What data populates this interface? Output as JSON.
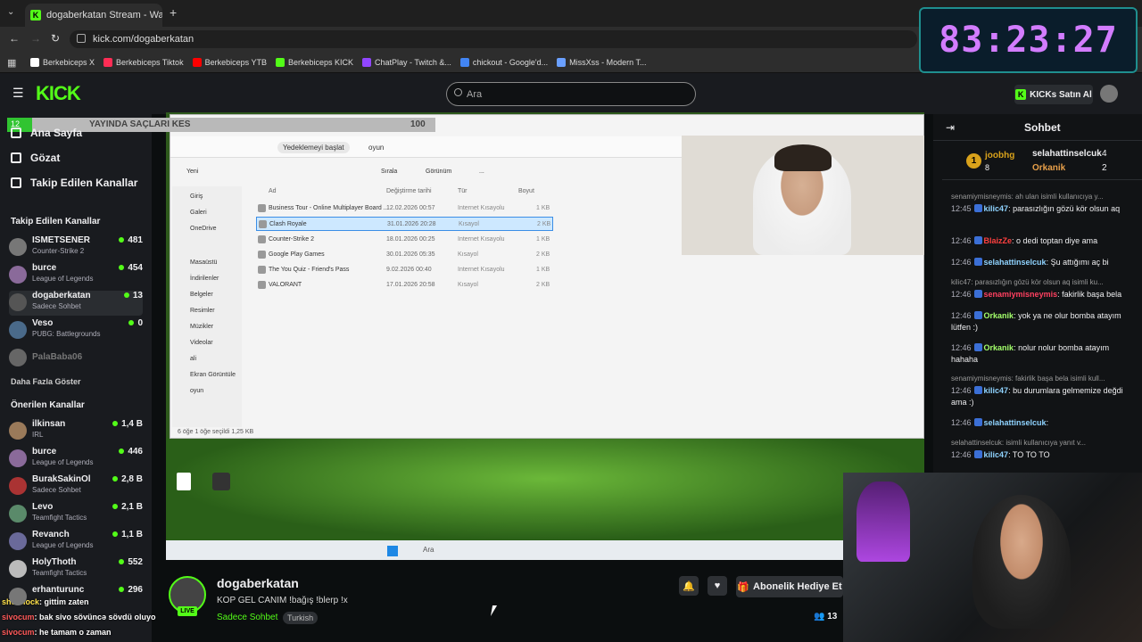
{
  "browser": {
    "tab_title": "dogaberkatan Stream - Wa",
    "url": "kick.com/dogaberkatan",
    "bookmarks": [
      {
        "label": "Berkebiceps X",
        "color": "#ffffff"
      },
      {
        "label": "Berkebiceps Tiktok",
        "color": "#ff2d55"
      },
      {
        "label": "Berkebiceps YTB",
        "color": "#ff0000"
      },
      {
        "label": "Berkebiceps KICK",
        "color": "#53fc18"
      },
      {
        "label": "ChatPlay - Twitch &...",
        "color": "#9146ff"
      },
      {
        "label": "chickout - Google'd...",
        "color": "#4285f4"
      },
      {
        "label": "MissXss - Modern T...",
        "color": "#6aa0ff"
      }
    ]
  },
  "timer": "83:23:27",
  "kick": {
    "logo": "KICK",
    "search_placeholder": "Ara",
    "buy_kicks": "KICKs Satın Al"
  },
  "sidebar": {
    "nav": [
      {
        "label": "Ana Sayfa",
        "icon": "home-icon"
      },
      {
        "label": "Gözat",
        "icon": "browse-icon"
      },
      {
        "label": "Takip Edilen Kanallar",
        "icon": "heart-icon"
      }
    ],
    "followed_title": "Takip Edilen Kanallar",
    "followed": [
      {
        "name": "ISMETSENER",
        "category": "Counter-Strike 2",
        "viewers": "481",
        "color": "#777"
      },
      {
        "name": "burce",
        "category": "League of Legends",
        "viewers": "454",
        "color": "#8a6a9a"
      },
      {
        "name": "dogaberkatan",
        "category": "Sadece Sohbet",
        "viewers": "13",
        "color": "#555"
      },
      {
        "name": "Veso",
        "category": "PUBG: Battlegrounds",
        "viewers": "0",
        "color": "#4a6a8a"
      },
      {
        "name": "PalaBaba06",
        "category": "",
        "viewers": "",
        "color": "#666"
      }
    ],
    "show_more": "Daha Fazla Göster",
    "recommended_title": "Önerilen Kanallar",
    "recommended": [
      {
        "name": "ilkinsan",
        "category": "IRL",
        "viewers": "1,4 B",
        "color": "#9a7a5a"
      },
      {
        "name": "burce",
        "category": "League of Legends",
        "viewers": "446",
        "color": "#8a6a9a"
      },
      {
        "name": "BurakSakinOl",
        "category": "Sadece Sohbet",
        "viewers": "2,8 B",
        "color": "#aa3333"
      },
      {
        "name": "Levo",
        "category": "Teamfight Tactics",
        "viewers": "2,1 B",
        "color": "#5a8a6a"
      },
      {
        "name": "Revanch",
        "category": "League of Legends",
        "viewers": "1,1 B",
        "color": "#6a6a9a"
      },
      {
        "name": "HolyThoth",
        "category": "Teamfight Tactics",
        "viewers": "552",
        "color": "#bbbbbb"
      },
      {
        "name": "erhanturunc",
        "category": "",
        "viewers": "296",
        "color": "#777"
      }
    ]
  },
  "video": {
    "overlay_value": "12",
    "overlay_title": "YAYINDA SAÇLARI KES",
    "overlay_target": "100",
    "explorer": {
      "breadcrumb_start": "Yedeklemeyi başlat",
      "breadcrumb_folder": "oyun",
      "toolbar": [
        "Yeni",
        "Sırala",
        "Görünüm",
        "..."
      ],
      "columns": [
        "Ad",
        "Değiştirme tarihi",
        "Tür",
        "Boyut"
      ],
      "files": [
        {
          "name": "Business Tour - Online Multiplayer Board ...",
          "date": "12.02.2026 00:57",
          "type": "Internet Kısayolu",
          "size": "1 KB"
        },
        {
          "name": "Clash Royale",
          "date": "31.01.2026 20:28",
          "type": "Kısayol",
          "size": "2 KB"
        },
        {
          "name": "Counter-Strike 2",
          "date": "18.01.2026 00:25",
          "type": "Internet Kısayolu",
          "size": "1 KB"
        },
        {
          "name": "Google Play Games",
          "date": "30.01.2026 05:35",
          "type": "Kısayol",
          "size": "2 KB"
        },
        {
          "name": "The You Quiz - Friend's Pass",
          "date": "9.02.2026 00:40",
          "type": "Internet Kısayolu",
          "size": "1 KB"
        },
        {
          "name": "VALORANT",
          "date": "17.01.2026 20:58",
          "type": "Kısayol",
          "size": "2 KB"
        }
      ],
      "side": [
        "Giriş",
        "Galeri",
        "OneDrive",
        "Masaüstü",
        "İndirilenler",
        "Belgeler",
        "Resimler",
        "Müzikler",
        "Videolar",
        "ali",
        "Ekran Görüntüle",
        "oyun"
      ],
      "status": "6 öğe    1 öğe seçildi  1,25 KB"
    },
    "taskbar_search": "Ara"
  },
  "stream": {
    "streamer": "dogaberkatan",
    "live": "LIVE",
    "title": "KOP GEL CANIM !bağış !blerp !x",
    "category": "Sadece Sohbet",
    "language": "Turkish",
    "subscribe_gift": "Abonelik Hediye Et",
    "viewers": "13"
  },
  "chat": {
    "title": "Sohbet",
    "leaders": [
      {
        "name": "joobhg",
        "count": "8"
      },
      {
        "name": "selahattinselcuk",
        "count": "4"
      },
      {
        "name": "Orkanik",
        "count": "2"
      }
    ],
    "messages": [
      {
        "reply": "senamiymisneymis: ah ulan isimli kullanıcıya y...",
        "time": "12:45",
        "user": "kilic47",
        "color": "#8fd3ff",
        "text": ": parasızlığın gözü kör olsun aq"
      },
      {
        "time": "12:46",
        "user": "BlaizZe",
        "color": "#ff4040",
        "text": ": o dedi toptan diye ama"
      },
      {
        "time": "12:46",
        "user": "selahattinselcuk",
        "color": "#8fd3ff",
        "text": ": Şu attığımı aç bi"
      },
      {
        "reply": "kilic47: parasızlığın gözü kör olsun aq isimli ku...",
        "time": "12:46",
        "user": "senamiymisneymis",
        "color": "#ff4060",
        "text": ": fakirlik başa bela"
      },
      {
        "time": "12:46",
        "user": "Orkanik",
        "color": "#a4ff6b",
        "text": ": yok ya ne olur bomba atayım lütfen :)"
      },
      {
        "time": "12:46",
        "user": "Orkanik",
        "color": "#a4ff6b",
        "text": ": nolur nolur bomba atayım hahaha"
      },
      {
        "reply": "senamiymisneymis: fakirlik başa bela isimli kull...",
        "time": "12:46",
        "user": "kilic47",
        "color": "#8fd3ff",
        "text": ": bu durumlara gelmemize değdi ama :)"
      },
      {
        "time": "12:46",
        "user": "selahattinselcuk",
        "color": "#8fd3ff",
        "text": ":"
      },
      {
        "reply": "selahattinselcuk:  isimli kullanıcıya yanıt v...",
        "time": "12:46",
        "user": "kilic47",
        "color": "#8fd3ff",
        "text": ": TO TO TO"
      }
    ]
  },
  "overlay_chat": [
    {
      "user": "sheerlock",
      "text": ": gitti̇m zaten",
      "color": "#ffe14a"
    },
    {
      "user": "sivocum",
      "text": ": bak sivo sövüncə sövdü oluyo",
      "color": "#ff5a5a"
    },
    {
      "user": "sivocum",
      "text": ": he tamam o zaman",
      "color": "#ff5a5a"
    }
  ]
}
